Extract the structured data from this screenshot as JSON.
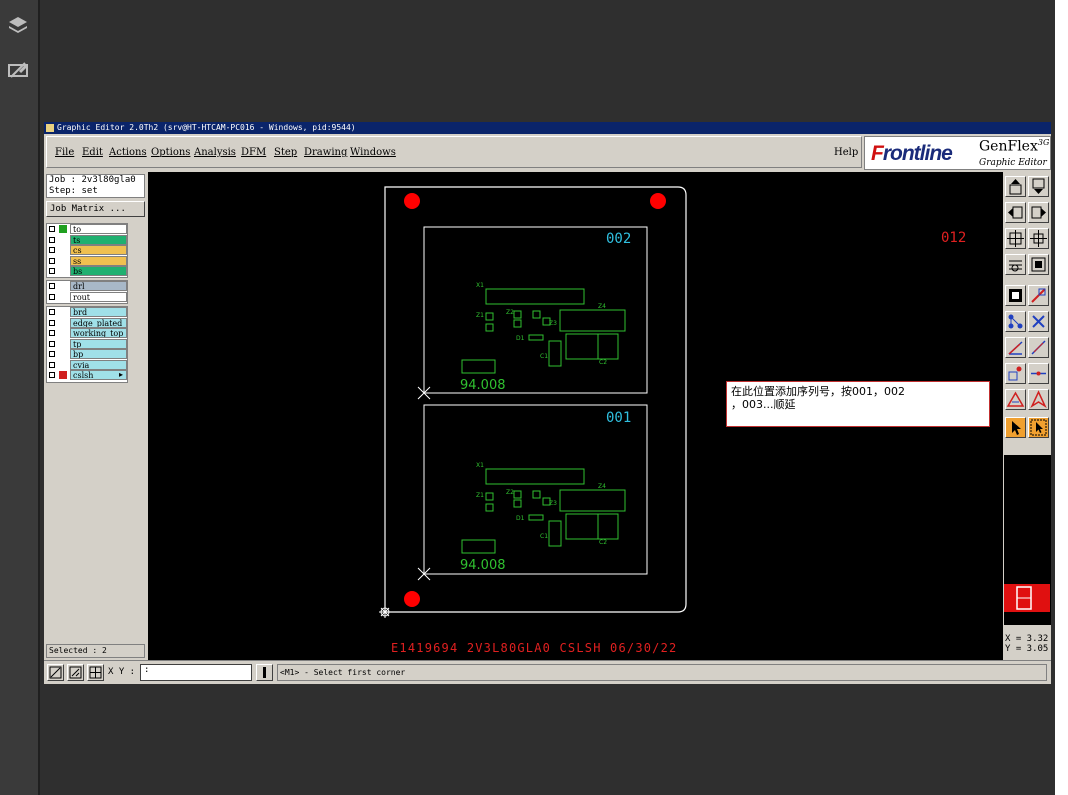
{
  "viewer": {
    "icons": [
      "layers-icon",
      "markup-pen-icon"
    ]
  },
  "window": {
    "title": "Graphic Editor 2.0Th2 (srv@HT-HTCAM-PC016 - Windows, pid:9544)"
  },
  "menubar": {
    "items": [
      "File",
      "Edit",
      "Actions",
      "Options",
      "Analysis",
      "DFM",
      "Step",
      "Drawing",
      "Windows"
    ],
    "help": "Help"
  },
  "logo": {
    "brand": "Frontline",
    "product": "GenFlex",
    "product_sup": "3G",
    "subtitle": "Graphic Editor"
  },
  "job": {
    "job_line": "Job : 2v3l80gla0",
    "step_line": "Step: set",
    "matrix_button": "Job Matrix ..."
  },
  "layers": {
    "group1": [
      {
        "name": "to",
        "color": "#ffffff",
        "active": "#20a020"
      },
      {
        "name": "ts",
        "color": "#20b070",
        "active": "#ffffff"
      },
      {
        "name": "cs",
        "color": "#f0c050",
        "active": "#ffffff"
      },
      {
        "name": "ss",
        "color": "#f0c050",
        "active": "#ffffff"
      },
      {
        "name": "bs",
        "color": "#20b070",
        "active": "#ffffff"
      }
    ],
    "group2": [
      {
        "name": "drl",
        "color": "#a8b8c8"
      },
      {
        "name": "rout",
        "color": "#ffffff"
      }
    ],
    "group3": [
      {
        "name": "brd",
        "color": "#a0e0e8"
      },
      {
        "name": "edge_plated",
        "color": "#a0e0e8"
      },
      {
        "name": "working_top",
        "color": "#a0e0e8"
      },
      {
        "name": "tp",
        "color": "#a0e0e8"
      },
      {
        "name": "bp",
        "color": "#a0e0e8"
      },
      {
        "name": "cvia",
        "color": "#a0e0e8"
      },
      {
        "name": "cslsh",
        "color": "#a0e0e8",
        "arrow": "▸"
      }
    ]
  },
  "selected": "Selected : 2",
  "canvas": {
    "panel_top_id": "002",
    "panel_bottom_id": "001",
    "next_id": "012",
    "board_label": "94.008",
    "parts": {
      "x1": "X1",
      "z1": "Z1",
      "z2": "Z2",
      "z3": "Z3",
      "z4": "Z4",
      "d1": "D1",
      "c1": "C1",
      "c2": "C2"
    },
    "footer_text": "E1419694 2V3L80GLA0 CSLSH 06/30/22",
    "note_line1": "在此位置添加序列号，按001，002",
    "note_line2": "，003...顺延"
  },
  "coords": {
    "x": "X = 3.32",
    "y": "Y = 3.05"
  },
  "statusbar": {
    "xy_label": "X Y :",
    "input_value": ":",
    "message": "<M1> - Select first corner"
  },
  "colors": {
    "panel_id": "#30c0e0",
    "next_id": "#e02020",
    "silk": "#30c030",
    "label": "#30c030",
    "footer": "#e02020",
    "fiducial": "#ff0000"
  }
}
